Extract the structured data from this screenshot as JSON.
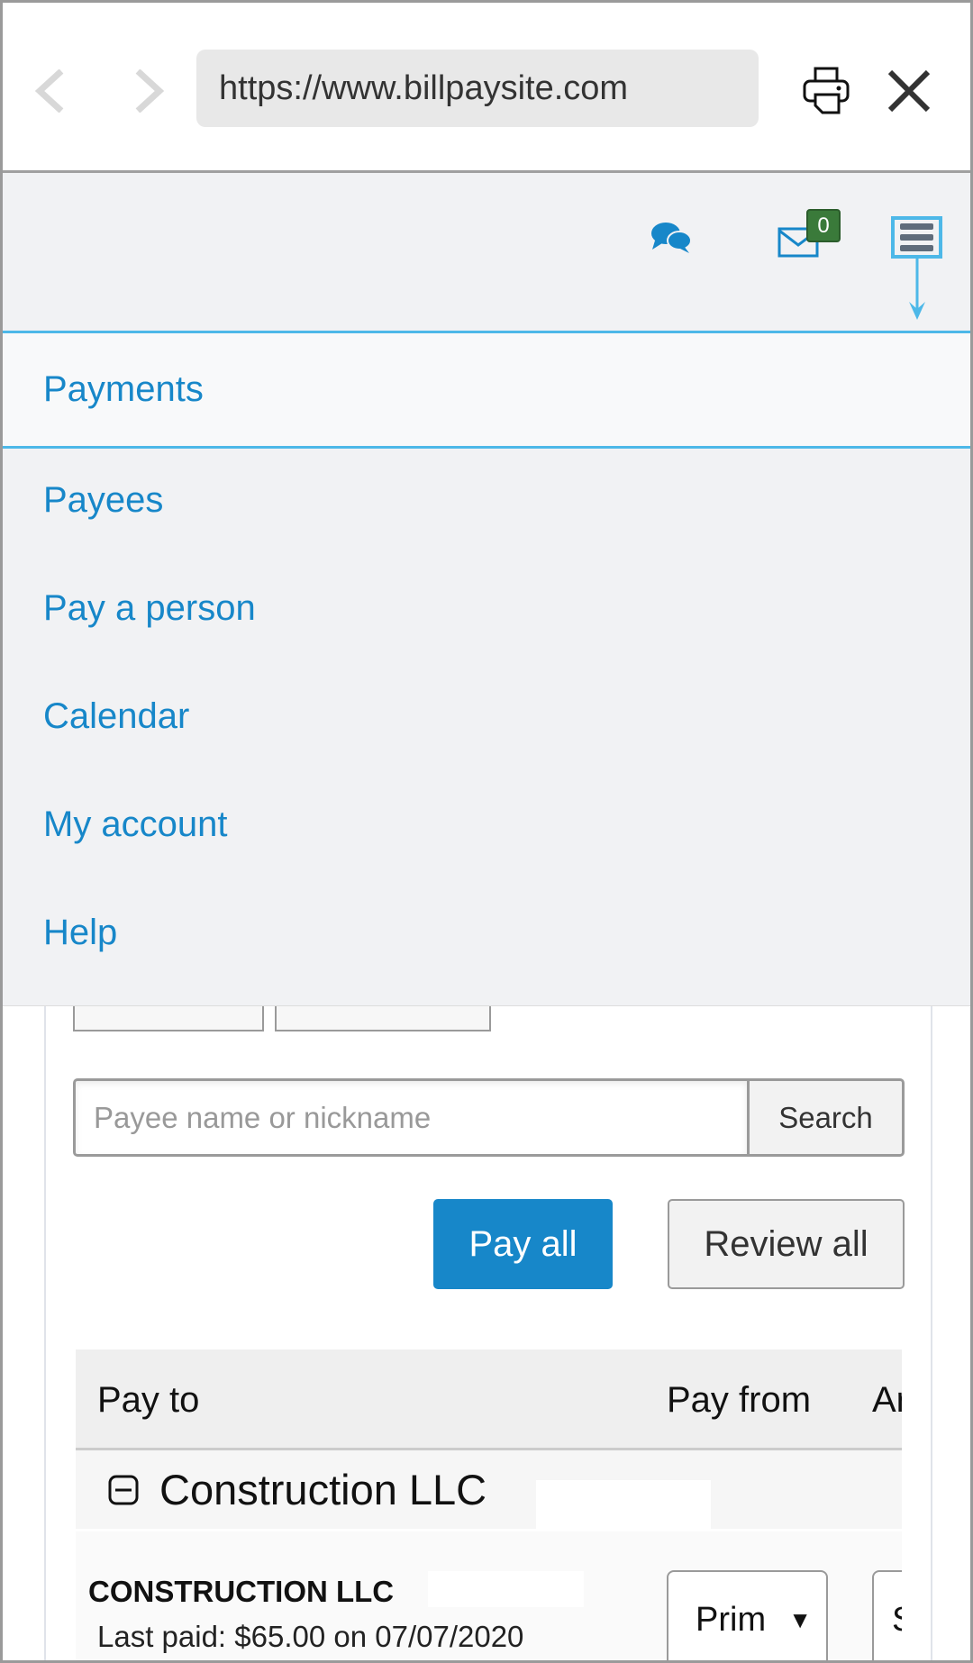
{
  "browser": {
    "url": "https://www.billpaysite.com",
    "icons": [
      "chevron-left-icon",
      "chevron-right-icon",
      "print-icon",
      "close-icon"
    ]
  },
  "header": {
    "mail_badge": "0",
    "colors": {
      "accent": "#1787c9",
      "badge": "#3a7a3a",
      "highlight": "#4db8e8"
    }
  },
  "menu": {
    "items": [
      {
        "label": "Payments",
        "selected": true
      },
      {
        "label": "Payees"
      },
      {
        "label": "Pay a person"
      },
      {
        "label": "Calendar"
      },
      {
        "label": "My account"
      },
      {
        "label": "Help"
      }
    ]
  },
  "search": {
    "placeholder": "Payee name or nickname",
    "button": "Search"
  },
  "actions": {
    "pay_all": "Pay all",
    "review_all": "Review all"
  },
  "table": {
    "headers": [
      "Pay to",
      "Pay from",
      "Ar"
    ],
    "group": {
      "name": "Construction LLC",
      "payee": "CONSTRUCTION LLC",
      "last_paid": "Last paid: $65.00 on 07/07/2020",
      "pay_from": "Prim",
      "amount_partial": "S"
    }
  }
}
